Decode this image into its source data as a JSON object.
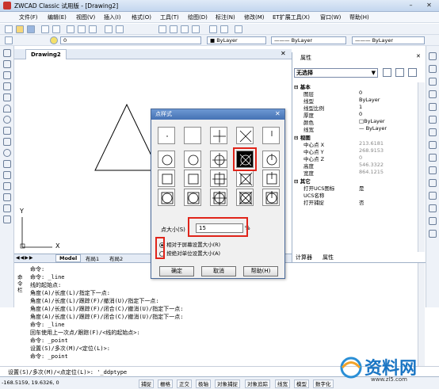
{
  "window": {
    "title": "ZWCAD Classic 试用版 - [Drawing2]"
  },
  "menu": [
    "文件(F)",
    "编辑(E)",
    "视图(V)",
    "插入(I)",
    "格式(O)",
    "工具(T)",
    "绘图(D)",
    "标注(N)",
    "修改(M)",
    "ET扩展工具(X)",
    "窗口(W)",
    "帮助(H)"
  ],
  "toolbar": {
    "layer_value": "0",
    "color_value": "ByLayer",
    "linetype_value": "ByLayer",
    "lineweight_value": "ByLayer"
  },
  "drawing": {
    "tab": "Drawing2",
    "layout_tabs": [
      "Model",
      "布局1",
      "布局2"
    ],
    "axis_x": "X",
    "axis_y": "Y"
  },
  "properties": {
    "title": "属性",
    "selection": "无选择",
    "sections": [
      {
        "name": "基本",
        "rows": [
          [
            "图层",
            "0"
          ],
          [
            "线型",
            "ByLayer"
          ],
          [
            "线型比例",
            "1"
          ],
          [
            "厚度",
            "0"
          ],
          [
            "颜色",
            "□ByLayer"
          ],
          [
            "线宽",
            "— ByLayer"
          ]
        ]
      },
      {
        "name": "视图",
        "rows": [
          [
            "中心点 X",
            "213.6181"
          ],
          [
            "中心点 Y",
            "268.9153"
          ],
          [
            "中心点 Z",
            "0"
          ],
          [
            "高度",
            "546.3322"
          ],
          [
            "宽度",
            "864.1215"
          ]
        ]
      },
      {
        "name": "其它",
        "rows": [
          [
            "打开UCS图标",
            "是"
          ],
          [
            "UCS名称",
            ""
          ],
          [
            "打开捕捉",
            "否"
          ]
        ]
      }
    ],
    "bottom_tabs": [
      "计算器",
      "属性"
    ]
  },
  "command": {
    "side_label": "命令栏",
    "lines": [
      "命令:",
      "命令: _line",
      "线的起始点:",
      "角度(A)/长度(L)/指定下一点:",
      "角度(A)/长度(L)/跟踪(F)/撤消(U)/指定下一点:",
      "角度(A)/长度(L)/跟踪(F)/闭合(C)/撤消(U)/指定下一点:",
      "角度(A)/长度(L)/跟踪(F)/闭合(C)/撤消(U)/指定下一点:",
      "命令: _line",
      "回车使用上一次点/跟踪(F)/<线的起始点>:",
      "命令: _point",
      "设置(S)/多次(M)/<定位(L)>:",
      "命令: _point"
    ],
    "prompt": "设置(S)/多次(M)/<点定位(L)>: '_ddptype"
  },
  "status": {
    "coords": "-168.5159, 19.6326, 0",
    "buttons": [
      "捕捉",
      "栅格",
      "正交",
      "极轴",
      "对象捕捉",
      "对象追踪",
      "线宽",
      "模型",
      "数字化"
    ]
  },
  "dialog": {
    "title": "点样式",
    "size_label": "点大小(S)",
    "size_value": "15",
    "size_unit": "%",
    "radio_relative": "相对于屏幕设置大小(R)",
    "radio_absolute": "按绝对单位设置大小(A)",
    "ok": "确定",
    "cancel": "取消",
    "help": "帮助(H)"
  },
  "watermark": {
    "text": "资料网",
    "url": "www.zl5.com"
  }
}
